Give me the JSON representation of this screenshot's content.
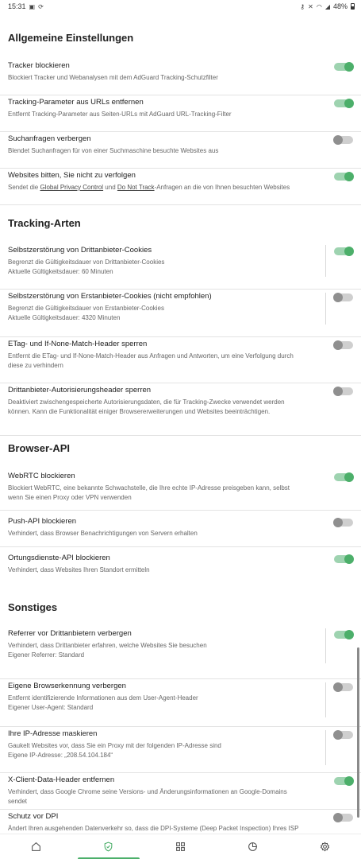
{
  "status_bar": {
    "time": "15:31",
    "battery": "48%"
  },
  "colors": {
    "accent": "#4caf6a",
    "toggle_off": "#8f8f8f"
  },
  "sections": {
    "general": {
      "title": "Allgemeine Einstellungen",
      "items": [
        {
          "title": "Tracker blockieren",
          "desc": "Blockiert Tracker und Webanalysen mit dem AdGuard Tracking-Schutzfilter",
          "on": true
        },
        {
          "title": "Tracking-Parameter aus URLs entfernen",
          "desc": "Entfernt Tracking-Parameter aus Seiten-URLs mit AdGuard URL-Tracking-Filter",
          "on": true
        },
        {
          "title": "Suchanfragen verbergen",
          "desc": "Blendet Suchanfragen für von einer Suchmaschine besuchte Websites aus",
          "on": false
        },
        {
          "title": "Websites bitten, Sie nicht zu verfolgen",
          "desc_parts": [
            "Sendet die ",
            "Global Privacy Control",
            " und ",
            "Do Not Track",
            "-Anfragen an die von Ihnen besuchten Websites"
          ],
          "on": true
        }
      ]
    },
    "tracking": {
      "title": "Tracking-Arten",
      "items": [
        {
          "title": "Selbstzerstörung von Drittanbieter-Cookies",
          "desc": "Begrenzt die Gültigkeitsdauer von Drittanbieter-Cookies",
          "desc2": "Aktuelle Gültigkeitsdauer: 60 Minuten",
          "on": true
        },
        {
          "title": "Selbstzerstörung von Erstanbieter-Cookies (nicht empfohlen)",
          "desc": "Begrenzt die Gültigkeitsdauer von Erstanbieter-Cookies",
          "desc2": "Aktuelle Gültigkeitsdauer: 4320 Minuten",
          "on": false
        },
        {
          "title": "ETag- und If-None-Match-Header sperren",
          "desc": "Entfernt die ETag- und If-None-Match-Header aus Anfragen und Antworten, um eine Verfolgung durch diese zu verhindern",
          "on": false
        },
        {
          "title": "Drittanbieter-Autorisierungsheader sperren",
          "desc": "Deaktiviert zwischengespeicherte Autorisierungsdaten, die für Tracking-Zwecke verwendet werden können. Kann die Funktionalität einiger Browsererweiterungen und Websites beeinträchtigen.",
          "on": false
        }
      ]
    },
    "browser_api": {
      "title": "Browser-API",
      "items": [
        {
          "title": "WebRTC blockieren",
          "desc": "Blockiert WebRTC, eine bekannte Schwachstelle, die Ihre echte IP-Adresse preisgeben kann, selbst wenn Sie einen Proxy oder VPN verwenden",
          "on": true
        },
        {
          "title": "Push-API blockieren",
          "desc": "Verhindert, dass Browser Benachrichtigungen von Servern erhalten",
          "on": false
        },
        {
          "title": "Ortungsdienste-API blockieren",
          "desc": "Verhindert, dass Websites Ihren Standort ermitteln",
          "on": true
        }
      ]
    },
    "misc": {
      "title": "Sonstiges",
      "items": [
        {
          "title": "Referrer vor Drittanbietern verbergen",
          "desc": "Verhindert, dass Drittanbieter erfahren, welche Websites Sie besuchen",
          "desc2": "Eigener Referrer: Standard",
          "on": true
        },
        {
          "title": "Eigene Browserkennung verbergen",
          "desc": "Entfernt identifizierende Informationen aus dem User-Agent-Header",
          "desc2": "Eigener User-Agent: Standard",
          "on": false
        },
        {
          "title": "Ihre IP-Adresse maskieren",
          "desc": "Gaukelt Websites vor, dass Sie ein Proxy mit der folgenden IP-Adresse sind",
          "desc2": "Eigene IP-Adresse: „208.54.104.184“",
          "on": false
        },
        {
          "title": "X-Client-Data-Header entfernen",
          "desc": "Verhindert, dass Google Chrome seine Versions- und Änderungsinformationen an Google-Domains sendet",
          "on": true
        },
        {
          "title": "Schutz vor DPI",
          "desc": "Ändert Ihren ausgehenden Datenverkehr so, dass die DPI-Systeme (Deep Packet Inspection) Ihres ISP",
          "on": false
        }
      ]
    }
  },
  "nav": {
    "items": [
      "home-icon",
      "shield-icon",
      "apps-icon",
      "stats-icon",
      "settings-icon"
    ],
    "active_index": 1
  }
}
